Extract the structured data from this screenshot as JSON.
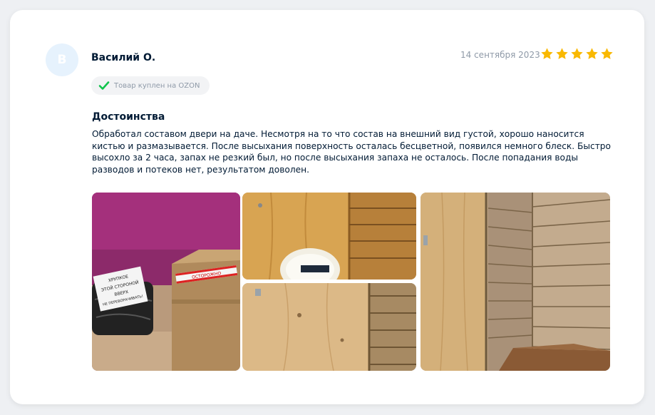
{
  "review": {
    "avatar_letter": "В",
    "author": "Василий О.",
    "date": "14 сентября 2023",
    "rating": 5,
    "rating_max": 5,
    "purchase_badge": "Товар куплен на OZON",
    "section_title": "Достоинства",
    "text": "Обработал составом двери на даче. Несмотря на то что состав на внешний вид густой, хорошо наносится кистью и размазывается. После высыхания поверхность осталась бесцветной, появился немного блеск. Быстро высохло за 2 часа, запах не резкий был, но после высыхания запаха не осталось. После попадания воды разводов и потеков нет, результатом доволен.",
    "photos": [
      {
        "icon": "photo-packages",
        "box_label_1": "ОСТОРОЖНО",
        "box_label_2": "ХРУПКОЕ",
        "box_label_3": "ЭТОЙ СТОРОНОЙ",
        "box_label_4": "ВВЕРХ",
        "box_label_5": "НЕ ПЕРЕВОРАЧИВАТЬ!"
      },
      {
        "icon": "photo-wood-wall-bucket"
      },
      {
        "icon": "photo-wood-door"
      },
      {
        "icon": "photo-wooden-room-corner"
      }
    ]
  },
  "colors": {
    "star": "#f9b800",
    "check": "#10c44c",
    "avatar_bg": "#e6f2fd",
    "muted_text": "#8f9aa8",
    "primary_text": "#001a34"
  }
}
